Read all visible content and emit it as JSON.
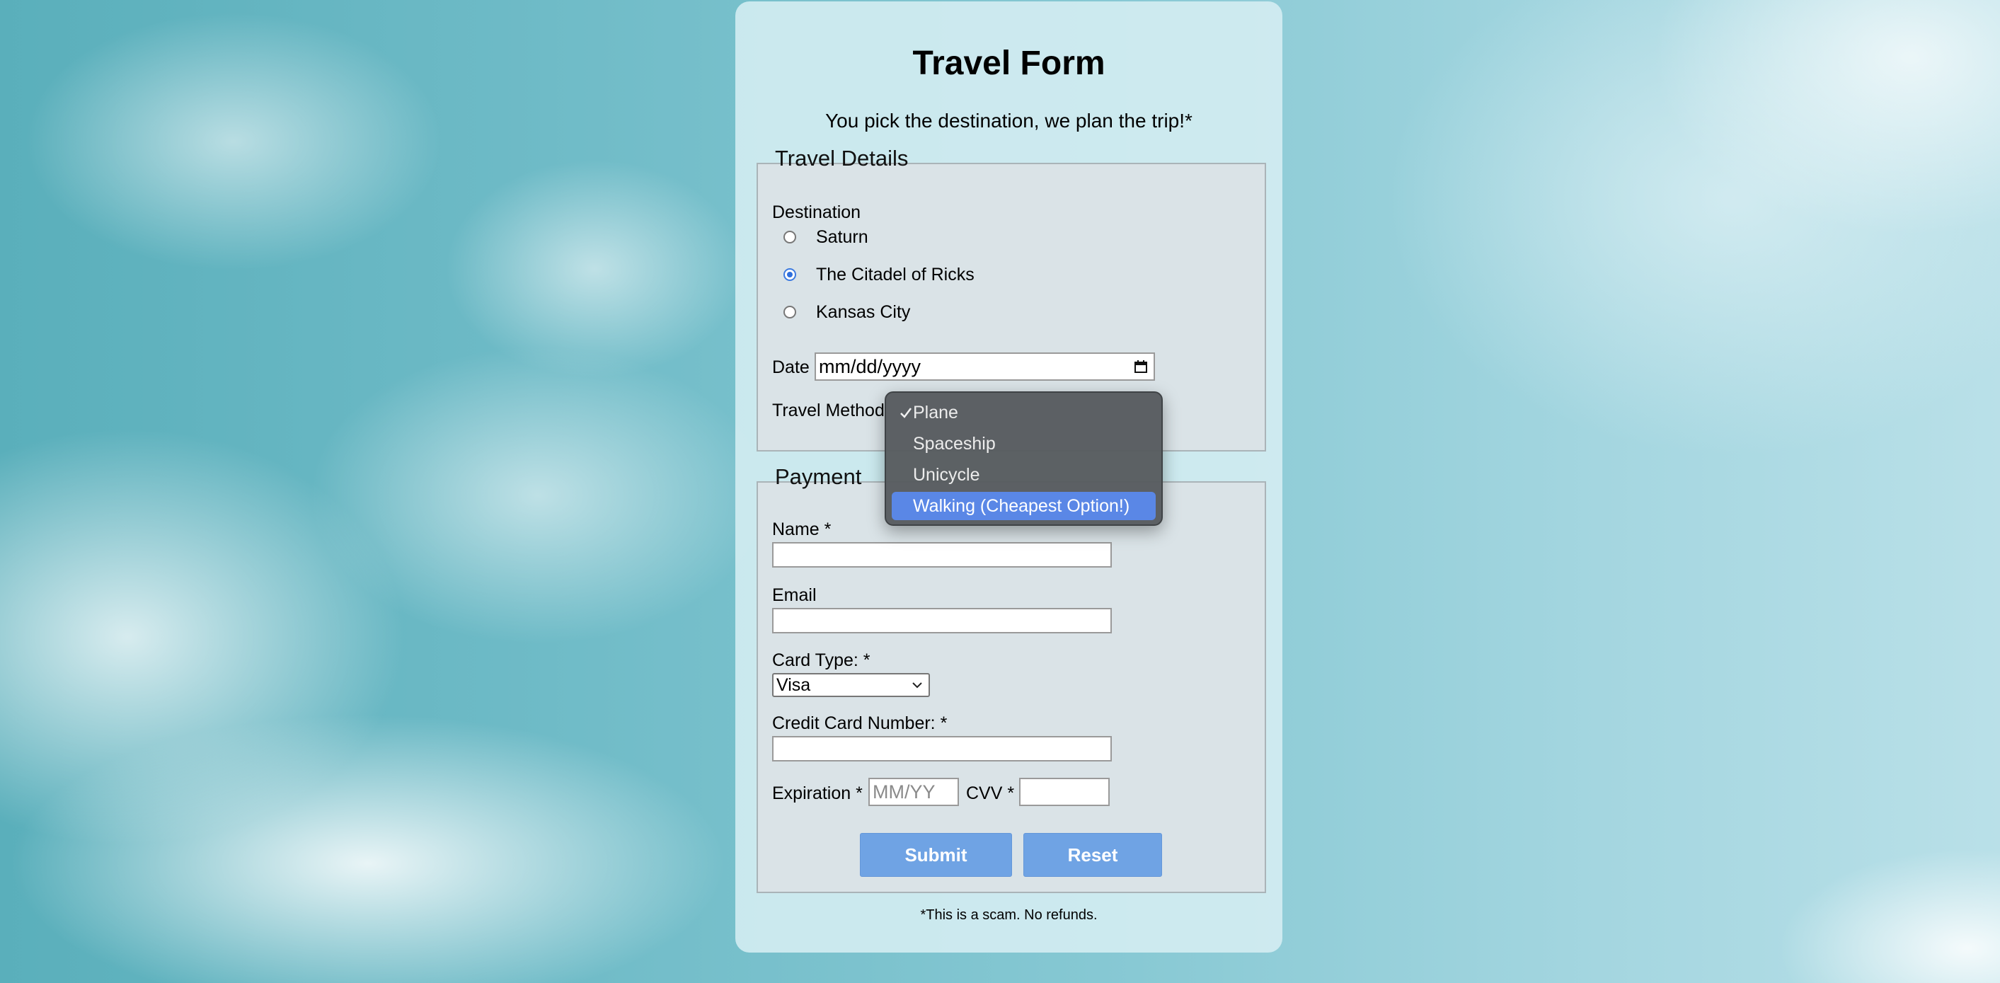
{
  "form": {
    "title": "Travel Form",
    "subtitle": "You pick the destination, we plan the trip!*",
    "footnote": "*This is a scam. No refunds."
  },
  "travel_details": {
    "legend": "Travel Details",
    "destination_label": "Destination",
    "destinations": [
      {
        "label": "Saturn",
        "checked": false
      },
      {
        "label": "The Citadel of Ricks",
        "checked": true
      },
      {
        "label": "Kansas City",
        "checked": false
      }
    ],
    "date_label": "Date",
    "date_placeholder": "mm/dd/yyyy",
    "travel_method_label": "Travel Method"
  },
  "travel_method_dropdown": {
    "options": [
      "Plane",
      "Spaceship",
      "Unicycle",
      "Walking (Cheapest Option!)"
    ],
    "selected": "Plane",
    "highlighted": "Walking (Cheapest Option!)",
    "check_icon": "checkmark-icon"
  },
  "payment": {
    "legend": "Payment",
    "name_label": "Name *",
    "email_label": "Email",
    "card_type_label": "Card Type: *",
    "card_type_value": "Visa",
    "credit_card_label": "Credit Card Number: *",
    "expiration_label": "Expiration *",
    "expiration_placeholder": "MM/YY",
    "cvv_label": "CVV *"
  },
  "buttons": {
    "submit": "Submit",
    "reset": "Reset"
  },
  "colors": {
    "button_bg": "#6fa3e4",
    "dropdown_highlight": "#5a87e6",
    "radio_accent": "#2f6fdc"
  }
}
